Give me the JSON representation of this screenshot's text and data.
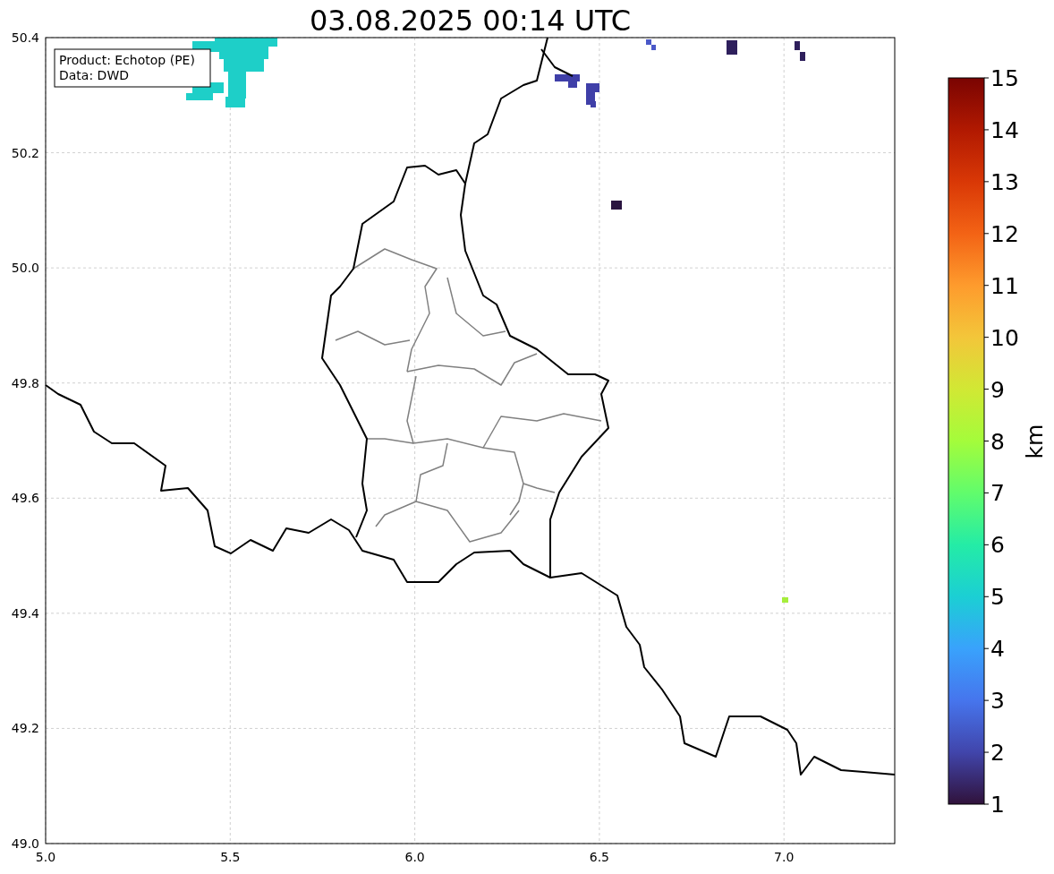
{
  "title": "03.08.2025 00:14 UTC",
  "info_box": {
    "lines": [
      "Product: Echotop (PE)",
      "Data: DWD"
    ]
  },
  "x_axis": {
    "ticks": [
      "5.0",
      "5.5",
      "6.0",
      "6.5",
      "7.0"
    ]
  },
  "y_axis": {
    "ticks": [
      "50.4",
      "50.2",
      "50.0",
      "49.8",
      "49.6",
      "49.4",
      "49.2",
      "49.0"
    ]
  },
  "colorbar": {
    "ticks": [
      "15",
      "14",
      "13",
      "12",
      "11",
      "10",
      "9",
      "8",
      "7",
      "6",
      "5",
      "4",
      "3",
      "2",
      "1"
    ],
    "label": "km"
  }
}
